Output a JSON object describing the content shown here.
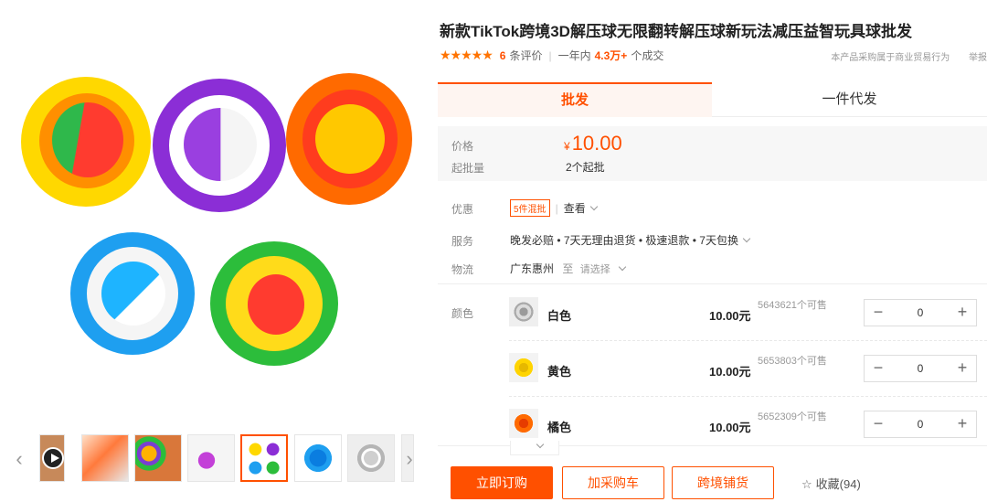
{
  "product": {
    "title": "新款TikTok跨境3D解压球无限翻转解压球新玩法减压益智玩具球批发",
    "rating_stars": "★★★★★",
    "review_count": "6",
    "review_label": "条评价",
    "deals_prefix": "一年内",
    "deals_count": "4.3万+",
    "deals_suffix": "个成交",
    "trade_notice": "本产品采购属于商业贸易行为",
    "report_label": "举报"
  },
  "tabs": [
    {
      "label": "批发",
      "active": true
    },
    {
      "label": "一件代发",
      "active": false
    }
  ],
  "pricing": {
    "price_label": "价格",
    "currency": "¥",
    "price": "10.00",
    "moq_label": "起批量",
    "moq": "2个起批"
  },
  "details": {
    "promo_label": "优惠",
    "promo_badge": "5件混批",
    "promo_view": "查看",
    "service_label": "服务",
    "service_text": "晚发必赔 • 7天无理由退货 • 极速退款 • 7天包换",
    "logistics_label": "物流",
    "logistics_from": "广东惠州",
    "logistics_to": "至",
    "logistics_select": "请选择",
    "color_label": "颜色"
  },
  "skus": [
    {
      "name": "白色",
      "price": "10.00元",
      "stock": "5643621个可售",
      "qty": "0",
      "swatch": "#d8d8d8"
    },
    {
      "name": "黄色",
      "price": "10.00元",
      "stock": "5653803个可售",
      "qty": "0",
      "swatch": "#ffd400"
    },
    {
      "name": "橘色",
      "price": "10.00元",
      "stock": "5652309个可售",
      "qty": "0",
      "swatch": "#ff6a00"
    }
  ],
  "actions": {
    "buy_now": "立即订购",
    "add_cart": "加采购车",
    "cross_border": "跨境铺货",
    "favorite": "收藏(94)"
  },
  "stepper": {
    "minus": "−",
    "plus": "+"
  },
  "colors": {
    "accent": "#ff5000",
    "star": "#ff7300"
  }
}
